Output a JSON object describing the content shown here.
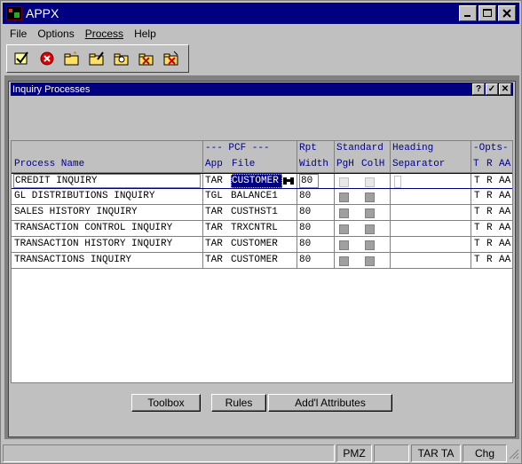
{
  "window": {
    "title": "APPX"
  },
  "menu": [
    "File",
    "Options",
    "Process",
    "Help"
  ],
  "toolbar": {
    "icons": [
      "check-icon",
      "cancel-icon",
      "folder-new-icon",
      "folder-edit-icon",
      "folder-find-icon",
      "folder-delete-icon",
      "folder-purge-icon"
    ]
  },
  "child_window": {
    "title": "Inquiry Processes",
    "buttons": [
      "?",
      "✓",
      "✕"
    ]
  },
  "table": {
    "header_top": {
      "pcf": "--- PCF ---",
      "rpt": "Rpt",
      "standard": "Standard",
      "heading": "Heading",
      "opts": "-Opts-"
    },
    "header_bottom": {
      "process_name": "Process Name",
      "app": "App",
      "file": "File",
      "width": "Width",
      "pgh": "PgH",
      "colh": "ColH",
      "separator": "Separator",
      "t": "T",
      "r": "R",
      "aa": "AA"
    },
    "rows": [
      {
        "name": "CREDIT INQUIRY",
        "app": "TAR",
        "file": "CUSTOMER",
        "width": "80",
        "t": "T",
        "r": "R",
        "aa": "AA"
      },
      {
        "name": "GL DISTRIBUTIONS INQUIRY",
        "app": "TGL",
        "file": "BALANCE1",
        "width": "80",
        "t": "T",
        "r": "R",
        "aa": "AA"
      },
      {
        "name": "SALES HISTORY INQUIRY",
        "app": "TAR",
        "file": "CUSTHST1",
        "width": "80",
        "t": "T",
        "r": "R",
        "aa": "AA"
      },
      {
        "name": "TRANSACTION CONTROL INQUIRY",
        "app": "TAR",
        "file": "TRXCNTRL",
        "width": "80",
        "t": "T",
        "r": "R",
        "aa": "AA"
      },
      {
        "name": "TRANSACTION HISTORY INQUIRY",
        "app": "TAR",
        "file": "CUSTOMER",
        "width": "80",
        "t": "T",
        "r": "R",
        "aa": "AA"
      },
      {
        "name": "TRANSACTIONS INQUIRY",
        "app": "TAR",
        "file": "CUSTOMER",
        "width": "80",
        "t": "T",
        "r": "R",
        "aa": "AA"
      }
    ]
  },
  "buttons": {
    "toolbox": "Toolbox",
    "rules": "Rules",
    "addl": "Add'l Attributes"
  },
  "status": {
    "p1": "",
    "p2": "PMZ",
    "p3": "",
    "p4": "TAR TA",
    "p5": "Chg"
  },
  "colors": {
    "title_bar": "#000080",
    "header_text": "#00008b",
    "selection": "#000080"
  }
}
